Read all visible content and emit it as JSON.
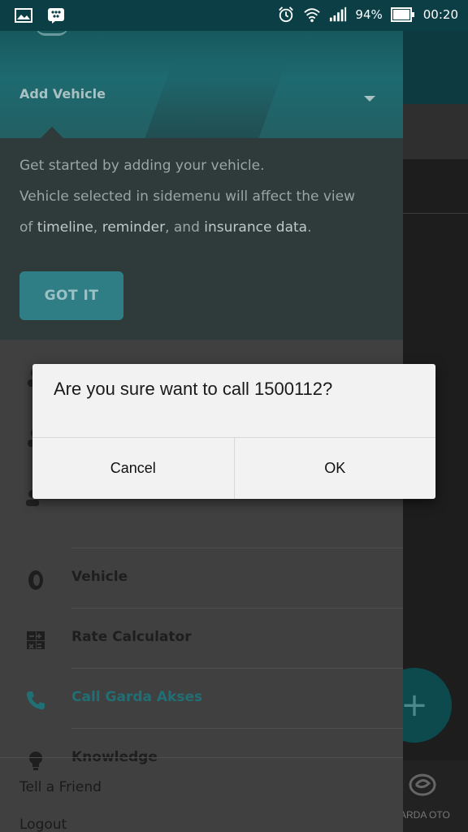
{
  "status_bar": {
    "battery_percent": "94%",
    "time": "00:20",
    "icons": [
      "image-icon",
      "bbm-icon",
      "alarm-icon",
      "wifi-icon",
      "signal-icon",
      "battery-icon"
    ]
  },
  "drawer": {
    "header_title": "Add Vehicle",
    "tutorial": {
      "line1": "Get started by adding your vehicle.",
      "line2": "Vehicle selected in sidemenu will affect the view",
      "line3_prefix": "of ",
      "line3_timeline": "timeline",
      "line3_sep1": ", ",
      "line3_reminder": "reminder",
      "line3_sep2": ", and ",
      "line3_insurance": "insurance data",
      "line3_suffix": ".",
      "button": "GOT IT"
    },
    "menu": {
      "items": [
        {
          "label": "Vehicle",
          "icon": "tire-icon"
        },
        {
          "label": "Rate Calculator",
          "icon": "calculator-icon"
        },
        {
          "label": "Call Garda Akses",
          "icon": "phone-icon"
        },
        {
          "label": "Knowledge",
          "icon": "lightbulb-icon"
        }
      ],
      "footer": {
        "tell_friend": "Tell a Friend",
        "logout": "Logout"
      }
    }
  },
  "background": {
    "fab_symbol": "+",
    "brand_text": "ARDA OTO"
  },
  "dialog": {
    "message": "Are you sure want to call 1500112?",
    "cancel": "Cancel",
    "ok": "OK"
  },
  "colors": {
    "accent": "#2f7e85",
    "call_highlight": "#1f6f75",
    "header_teal": "#1d6a70"
  }
}
